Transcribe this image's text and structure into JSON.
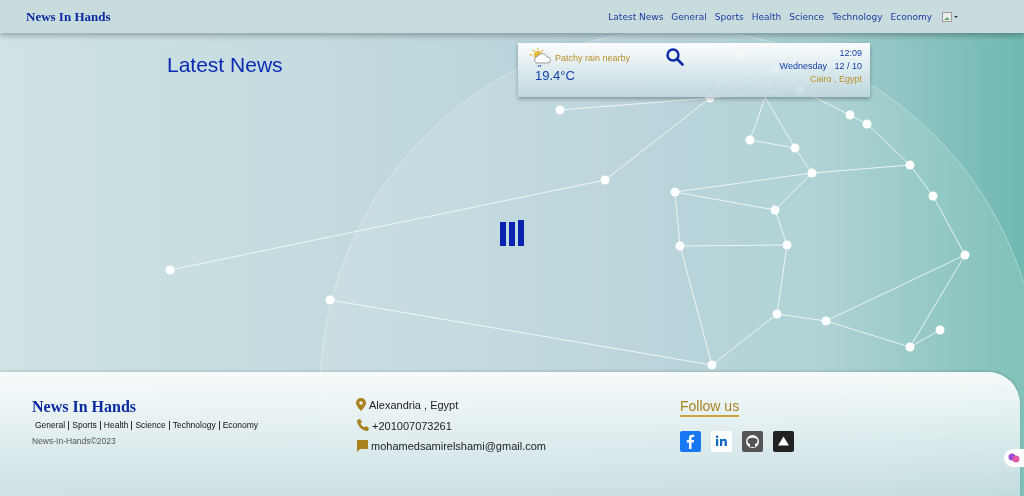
{
  "navbar": {
    "brand": "News In Hands",
    "links": [
      {
        "label": "Latest News"
      },
      {
        "label": "General"
      },
      {
        "label": "Sports"
      },
      {
        "label": "Health"
      },
      {
        "label": "Science"
      },
      {
        "label": "Technology"
      },
      {
        "label": "Economy"
      }
    ]
  },
  "heading": "Latest News",
  "weather": {
    "condition": "Patchy rain nearby",
    "temperature": "19.4",
    "unit": "°C",
    "time": "12:09",
    "day": "Wednesday",
    "date": "12 / 10",
    "location": "Cairo , Egypt"
  },
  "footer": {
    "brand": "News In Hands",
    "links": [
      "General",
      "Sports",
      "Health",
      "Science",
      "Technology",
      "Economy"
    ],
    "copyright": "News-In-Hands©2023",
    "contacts": [
      {
        "kind": "location",
        "text": "Alexandria , Egypt"
      },
      {
        "kind": "phone",
        "text": "+201007073261"
      },
      {
        "kind": "email",
        "text": "mohamedsamirelshami@gmail.com"
      }
    ],
    "follow_title": "Follow us",
    "socials": [
      {
        "kind": "facebook"
      },
      {
        "kind": "linkedin"
      },
      {
        "kind": "github"
      },
      {
        "kind": "triangle"
      }
    ]
  }
}
